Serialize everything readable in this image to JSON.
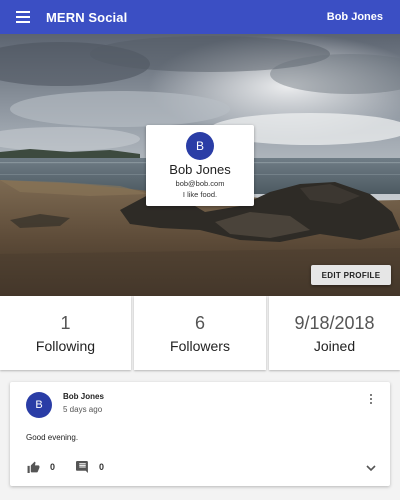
{
  "appbar": {
    "title": "MERN Social",
    "user_name": "Bob Jones",
    "menu_icon": "menu-icon",
    "background": "#3b4fc4"
  },
  "profile": {
    "avatar_initial": "B",
    "name": "Bob Jones",
    "email": "bob@bob.com",
    "bio": "I like food.",
    "edit_label": "EDIT PROFILE"
  },
  "stats": [
    {
      "value": "1",
      "label": "Following"
    },
    {
      "value": "6",
      "label": "Followers"
    },
    {
      "value": "9/18/2018",
      "label": "Joined"
    }
  ],
  "post": {
    "avatar_initial": "B",
    "author": "Bob Jones",
    "time": "5 days ago",
    "text": "Good evening.",
    "likes": "0",
    "comments": "0",
    "icons": [
      "thumb-up-icon",
      "comment-icon",
      "more-vert-icon",
      "chevron-down-icon"
    ]
  },
  "colors": {
    "accent": "#3b4fc4",
    "avatar": "#2a3da6"
  }
}
